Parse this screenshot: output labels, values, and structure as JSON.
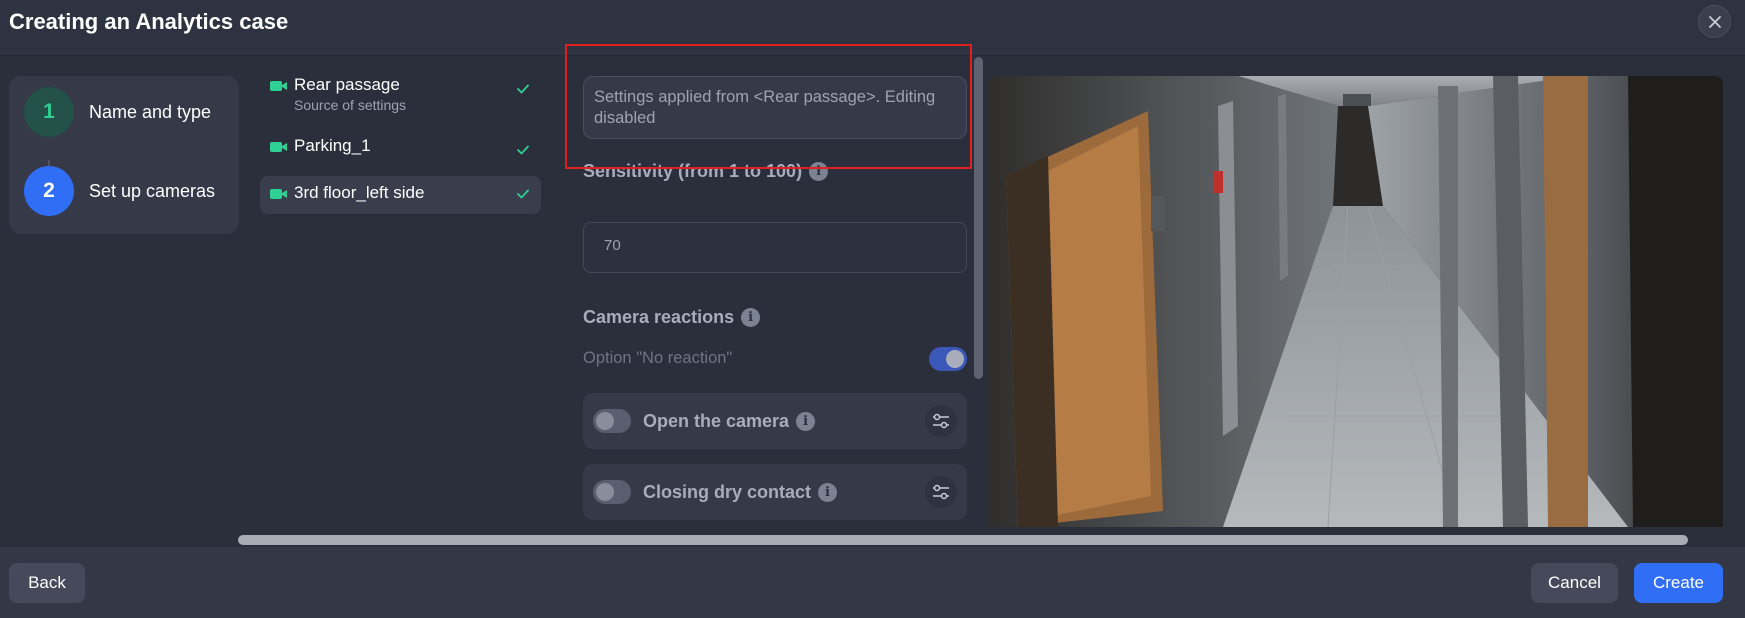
{
  "header": {
    "title": "Creating an Analytics case",
    "close_icon": "close-icon"
  },
  "steps": [
    {
      "number": "1",
      "label": "Name and type",
      "state": "completed",
      "color": "#2ed193"
    },
    {
      "number": "2",
      "label": "Set up cameras",
      "state": "active",
      "color": "#2f6ef5"
    }
  ],
  "cameras": [
    {
      "name": "Rear passage",
      "subtitle": "Source of settings",
      "icon": "camera-icon",
      "checked": true
    },
    {
      "name": "Parking_1",
      "subtitle": "",
      "icon": "camera-icon",
      "checked": true
    },
    {
      "name": "3rd floor_left side",
      "subtitle": "",
      "icon": "camera-icon",
      "checked": true,
      "selected": true
    }
  ],
  "settings": {
    "notice": "Settings applied from <Rear passage>. Editing disabled",
    "sensitivity_label": "Sensitivity (from 1 to 100)",
    "sensitivity_value": "70",
    "reactions_label": "Camera reactions",
    "no_reaction_label": "Option \"No reaction\"",
    "no_reaction_enabled": true,
    "reactions": [
      {
        "label": "Open the camera",
        "enabled": false
      },
      {
        "label": "Closing dry contact",
        "enabled": false
      }
    ]
  },
  "footer": {
    "back_label": "Back",
    "cancel_label": "Cancel",
    "create_label": "Create"
  },
  "colors": {
    "accent": "#2f6ef5",
    "success": "#2ed193",
    "highlight": "#e0201f"
  }
}
